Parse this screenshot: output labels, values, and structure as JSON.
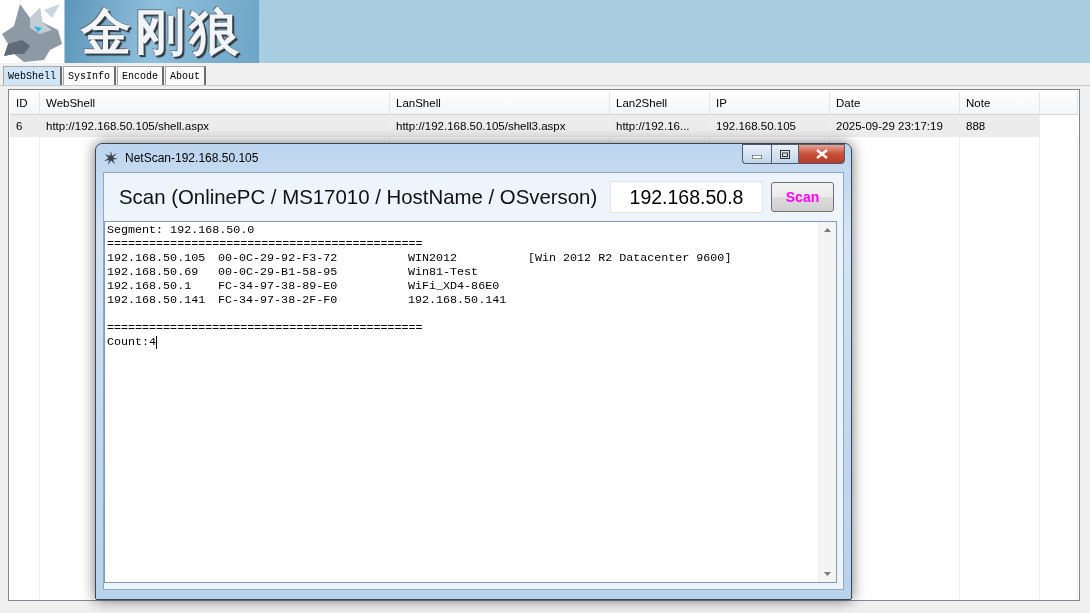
{
  "banner": {
    "logo_text": "金刚狼"
  },
  "tabs": [
    {
      "label": "WebShell",
      "selected": true
    },
    {
      "label": "SysInfo",
      "selected": false
    },
    {
      "label": "Encode",
      "selected": false
    },
    {
      "label": "About",
      "selected": false
    }
  ],
  "table": {
    "columns": [
      "ID",
      "WebShell",
      "LanShell",
      "Lan2Shell",
      "IP",
      "Date",
      "Note"
    ],
    "rows": [
      {
        "selected": true,
        "cells": [
          "6",
          "http://192.168.50.105/shell.aspx",
          "http://192.168.50.105/shell3.aspx",
          "http://192.16...",
          "192.168.50.105",
          "2025-09-29 23:17:19",
          "888"
        ]
      }
    ]
  },
  "scan_window": {
    "title": "NetScan-192.168.50.105",
    "scan_label": "Scan (OnlinePC / MS17010 / HostName / OSverson)",
    "ip_field": {
      "value": "192.168.50.8"
    },
    "scan_button": "Scan",
    "output": {
      "segment": "Segment: 192.168.50.0",
      "separator_top": "=============================================",
      "hosts": [
        {
          "ip": "192.168.50.105",
          "mac": "00-0C-29-92-F3-72",
          "hostname": "WIN2012",
          "os": "[Win 2012 R2 Datacenter 9600]"
        },
        {
          "ip": "192.168.50.69",
          "mac": "00-0C-29-B1-58-95",
          "hostname": "Win81-Test"
        },
        {
          "ip": "192.168.50.1",
          "mac": "FC-34-97-38-89-E0",
          "hostname": "WiFi_XD4-86E0"
        },
        {
          "ip": "192.168.50.141",
          "mac": "FC-34-97-38-2F-F0",
          "hostname": "192.168.50.141"
        }
      ],
      "separator_bottom": "=============================================",
      "count": "Count:4"
    }
  }
}
